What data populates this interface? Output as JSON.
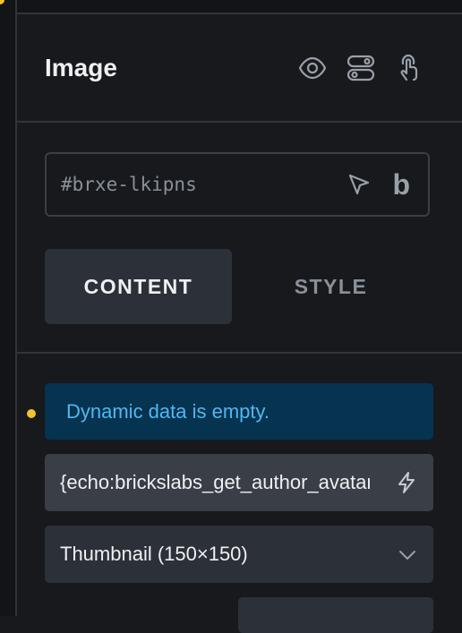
{
  "panel": {
    "title": "Image",
    "icons": [
      "eye-icon",
      "toggle-icon",
      "pointer-hand-icon"
    ]
  },
  "id_field": {
    "value": "#brxe-lkipns",
    "cursor_icon": "cursor-arrow-icon",
    "brand_glyph": "b"
  },
  "tabs": [
    {
      "label": "CONTENT",
      "active": true
    },
    {
      "label": "STYLE",
      "active": false
    }
  ],
  "notice": {
    "text": "Dynamic data is empty.",
    "color": "#4fb8f2",
    "background": "#053350"
  },
  "dynamic_field": {
    "value": "{echo:brickslabs_get_author_avatar}",
    "icon": "bolt-icon"
  },
  "size_select": {
    "value": "Thumbnail (150×150)",
    "icon": "chevron-down-icon"
  },
  "colors": {
    "background": "#17191d",
    "warning_dot": "#f2c230"
  }
}
